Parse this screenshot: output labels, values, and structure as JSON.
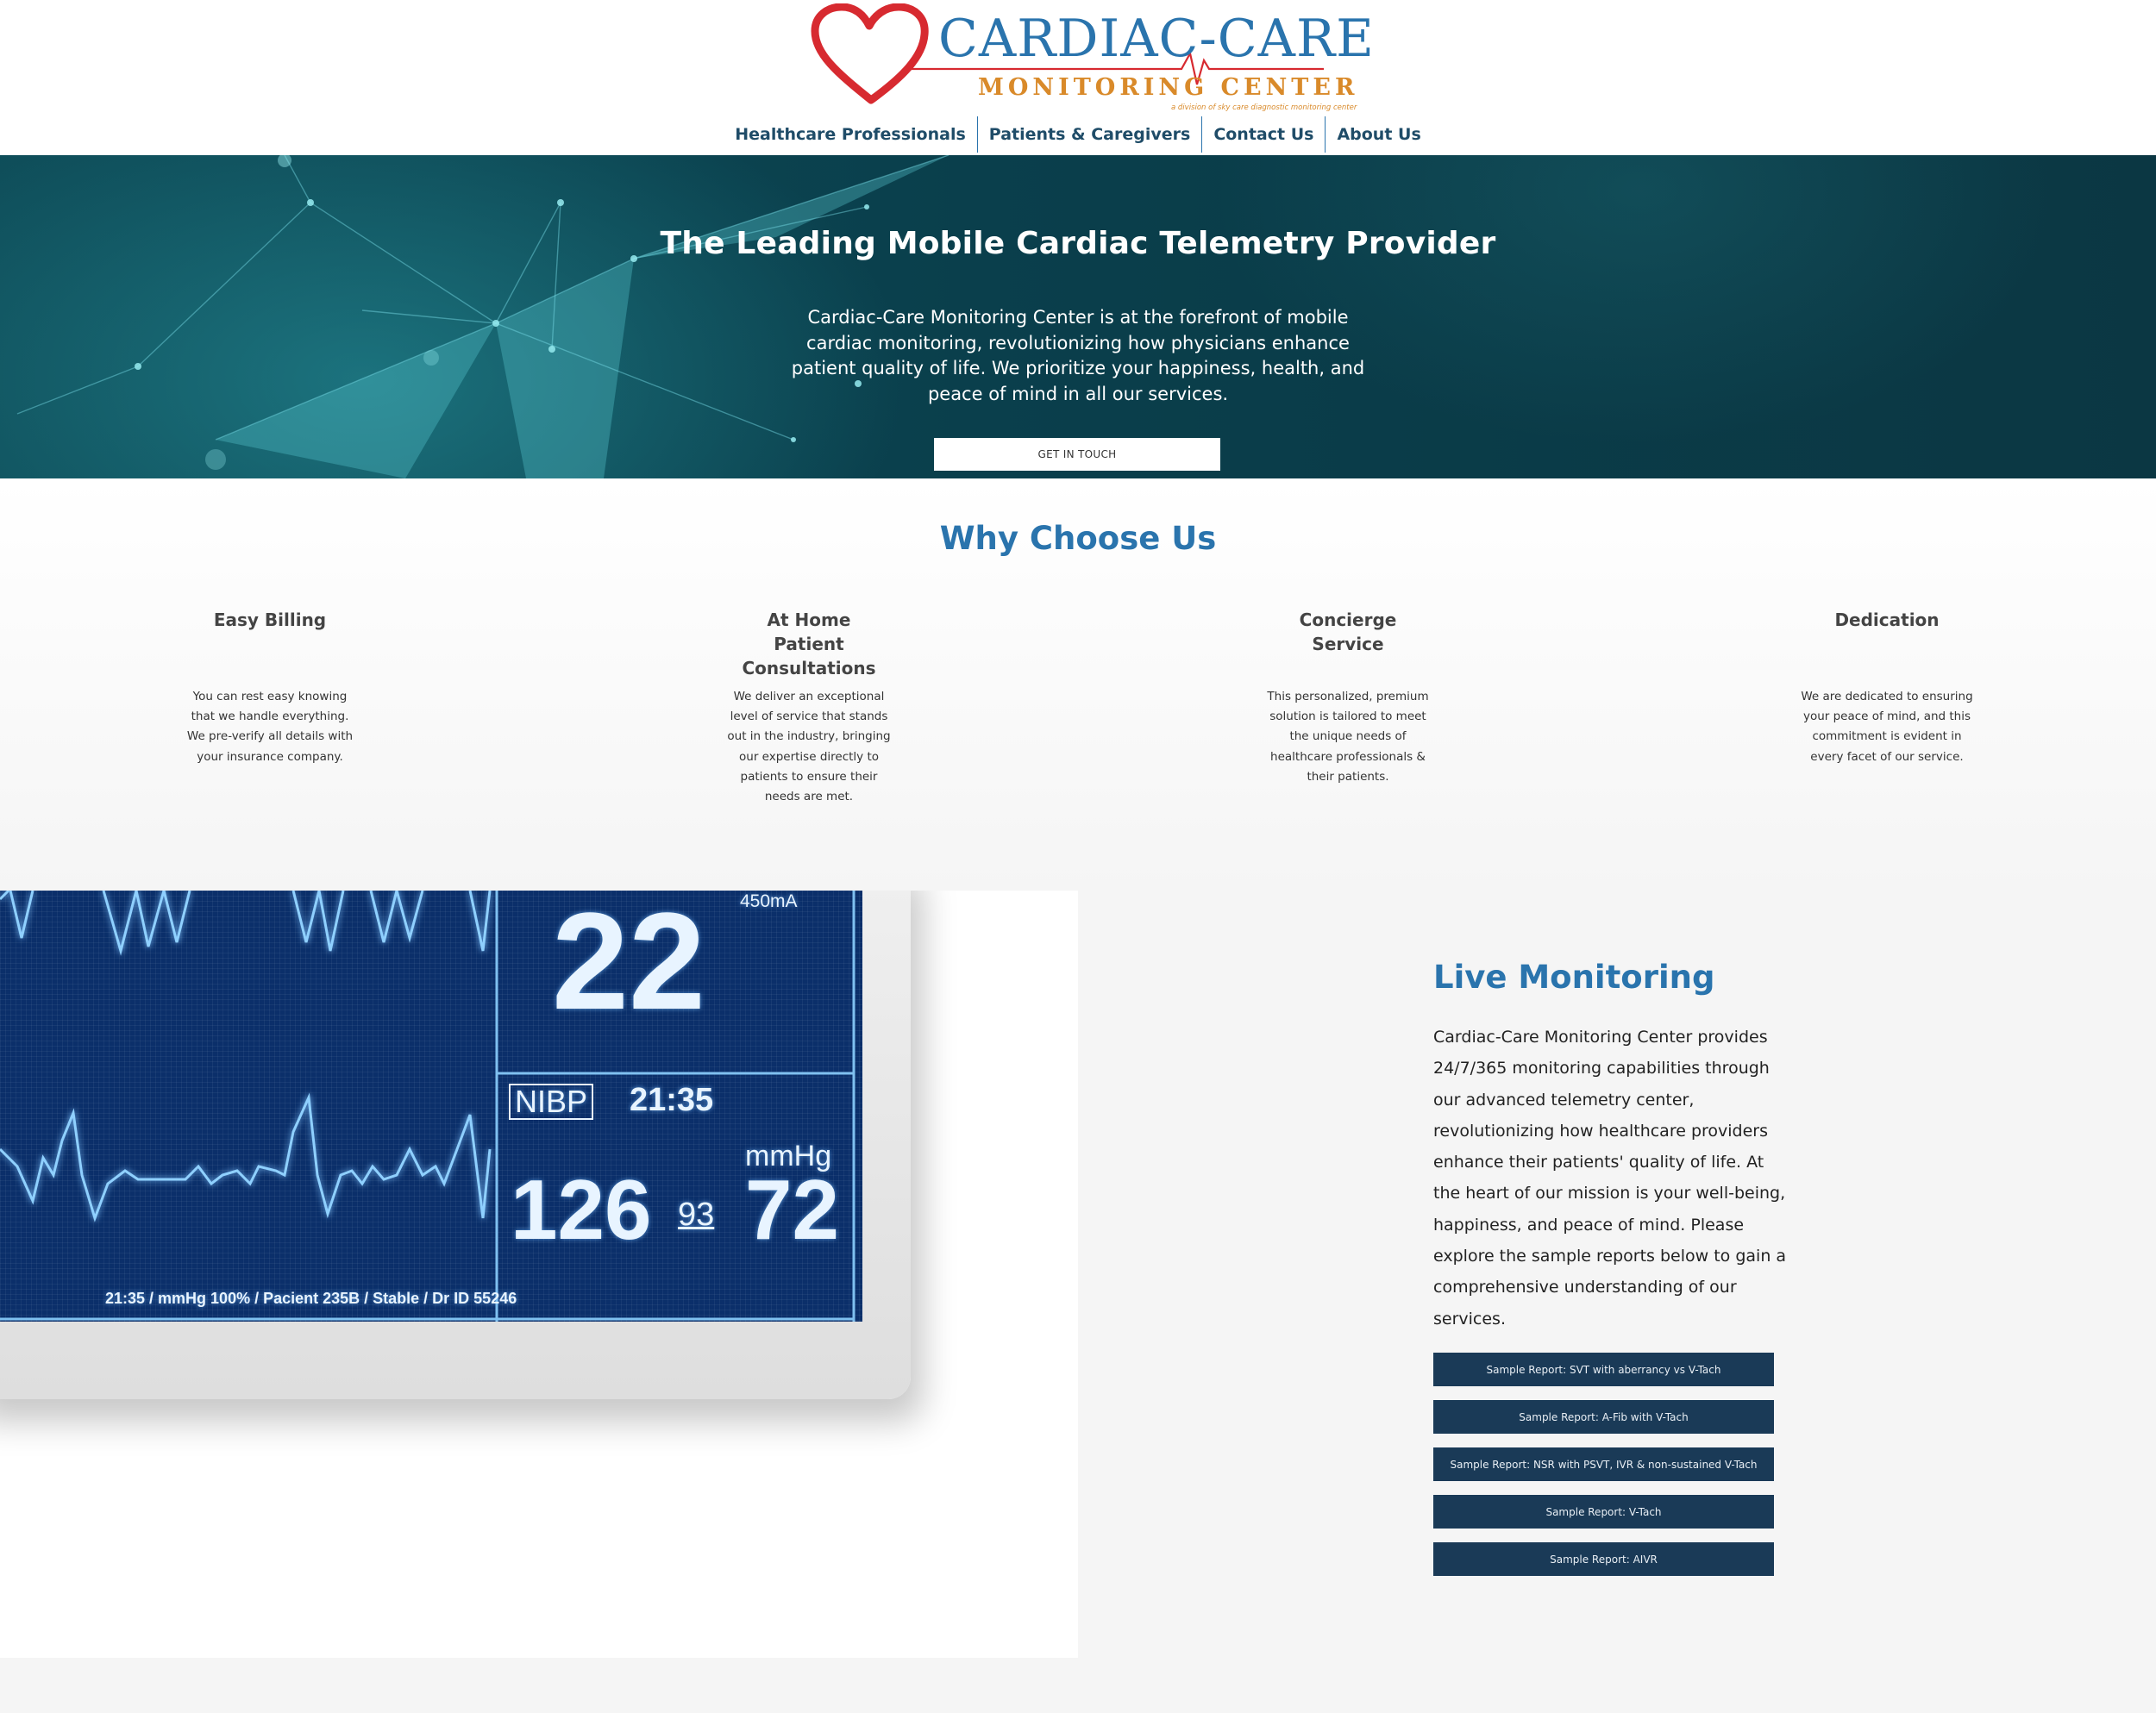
{
  "logo": {
    "title": "CARDIAC-CARE",
    "subtitle": "MONITORING CENTER",
    "tagline": "a division of sky care diagnostic monitoring center",
    "colors": {
      "blue": "#2a74ad",
      "red": "#d72a30",
      "orange": "#d98a2a"
    }
  },
  "nav": {
    "items": [
      {
        "label": "Healthcare Professionals"
      },
      {
        "label": "Patients & Caregivers"
      },
      {
        "label": "Contact Us"
      },
      {
        "label": "About Us"
      }
    ]
  },
  "hero": {
    "title": "The Leading Mobile Cardiac Telemetry Provider",
    "body": "Cardiac-Care Monitoring Center is at the forefront of mobile cardiac monitoring, revolutionizing how physicians enhance patient quality of life. We prioritize your happiness, health, and peace of mind in all our services.",
    "cta_label": "GET IN TOUCH"
  },
  "why": {
    "title": "Why Choose Us",
    "features": [
      {
        "title": "Easy Billing",
        "text": "You can rest easy knowing that we handle everything. We pre-verify all details with your insurance company."
      },
      {
        "title": "At Home Patient Consultations",
        "text": "We deliver an exceptional level of service that stands out in the industry, bringing our expertise directly to patients to ensure their needs are met."
      },
      {
        "title": "Concierge Service",
        "text": "This personalized, premium solution is tailored to meet the unique needs of healthcare professionals & their patients."
      },
      {
        "title": "Dedication",
        "text": "We are dedicated to ensuring your peace of mind, and this commitment is evident in every facet of our service."
      }
    ]
  },
  "monitor": {
    "value_big": "22",
    "current": "450mA",
    "nibp_label": "NIBP",
    "time": "21:35",
    "unit": "mmHg",
    "systolic": "126",
    "mean": "93",
    "diastolic": "72",
    "footer": "21:35 / mmHg 100% / Pacient 235B / Stable / Dr ID 55246"
  },
  "live": {
    "title": "Live Monitoring",
    "body": "Cardiac-Care Monitoring Center provides 24/7/365 monitoring capabilities through our advanced telemetry center, revolutionizing how healthcare providers enhance their patients' quality of life. At the heart of our mission is your well-being, happiness, and peace of mind. Please explore the sample reports below to gain a comprehensive understanding of our services.",
    "reports": [
      {
        "label": "Sample Report: SVT with aberrancy vs V-Tach"
      },
      {
        "label": "Sample Report: A-Fib with V-Tach"
      },
      {
        "label": "Sample Report: NSR with PSVT, IVR & non-sustained V-Tach"
      },
      {
        "label": "Sample Report: V-Tach"
      },
      {
        "label": "Sample Report: AIVR"
      }
    ]
  }
}
